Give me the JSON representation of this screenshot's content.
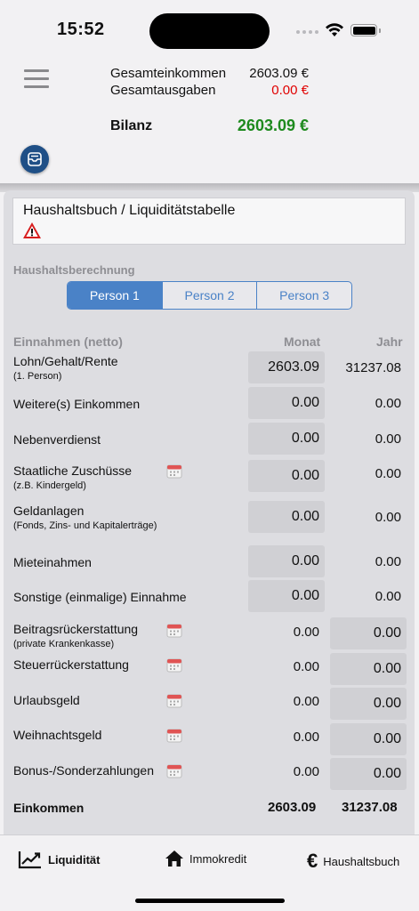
{
  "status": {
    "time": "15:52"
  },
  "summary": {
    "income_label": "Gesamteinkommen",
    "income_value": "2603.09 €",
    "expense_label": "Gesamtausgaben",
    "expense_value": "0.00 €",
    "balance_label": "Bilanz",
    "balance_value": "2603.09 €",
    "income_color": "#111111",
    "expense_color": "#e00000",
    "balance_color": "#1e8a1e"
  },
  "panel": {
    "title": "Haushaltsbuch / Liquiditätstabelle",
    "section_label": "Haushaltsberechnung",
    "persons": [
      "Person 1",
      "Person 2",
      "Person 3"
    ],
    "active_person": "Person 1"
  },
  "table": {
    "header_label": "Einnahmen (netto)",
    "header_monat": "Monat",
    "header_jahr": "Jahr",
    "rows": [
      {
        "label": "Lohn/Gehalt/Rente",
        "sub": "(1. Person)",
        "monat": "2603.09",
        "jahr": "31237.08"
      },
      {
        "label": "Weitere(s) Einkommen",
        "sub": "",
        "monat": "0.00",
        "jahr": "0.00"
      },
      {
        "label": "Nebenverdienst",
        "sub": "",
        "monat": "0.00",
        "jahr": "0.00"
      },
      {
        "label": "Staatliche Zuschüsse",
        "sub": "(z.B. Kindergeld)",
        "monat": "0.00",
        "jahr": "0.00"
      },
      {
        "label": "Geldanlagen",
        "sub": "(Fonds, Zins- und Kapitalerträge)",
        "monat": "0.00",
        "jahr": "0.00"
      },
      {
        "label": "Mieteinahmen",
        "sub": "",
        "monat": "0.00",
        "jahr": "0.00"
      },
      {
        "label": "Sonstige (einmalige) Einnahme",
        "sub": "",
        "monat": "0.00",
        "jahr": "0.00"
      },
      {
        "label": "Beitragsrückerstattung",
        "sub": "(private Krankenkasse)",
        "monat": "0.00",
        "jahr": "0.00"
      },
      {
        "label": "Steuerrückerstattung",
        "sub": "",
        "monat": "0.00",
        "jahr": "0.00"
      },
      {
        "label": "Urlaubsgeld",
        "sub": "",
        "monat": "0.00",
        "jahr": "0.00"
      },
      {
        "label": "Weihnachtsgeld",
        "sub": "",
        "monat": "0.00",
        "jahr": "0.00"
      },
      {
        "label": "Bonus-/Sonderzahlungen",
        "sub": "",
        "monat": "0.00",
        "jahr": "0.00"
      }
    ],
    "total_label": "Einkommen",
    "total_monat": "2603.09",
    "total_jahr": "31237.08"
  },
  "tabbar": {
    "items": [
      {
        "label": "Liquidität",
        "icon": "chart-line-icon"
      },
      {
        "label": "Immokredit",
        "icon": "home-icon"
      },
      {
        "label": "Haushaltsbuch",
        "icon": "euro-icon"
      }
    ],
    "active": "Liquidität"
  }
}
